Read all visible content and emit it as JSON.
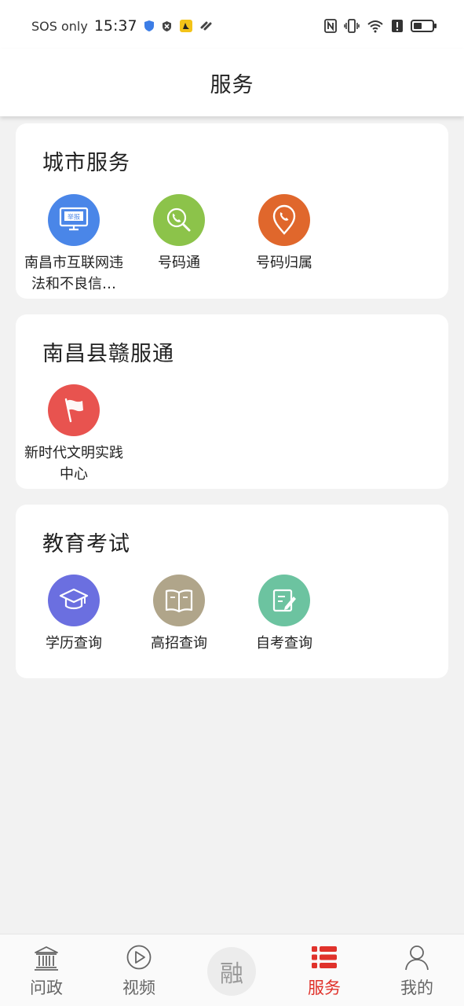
{
  "status_bar": {
    "carrier": "SOS only",
    "time": "15:37"
  },
  "header": {
    "title": "服务"
  },
  "sections": [
    {
      "title": "城市服务",
      "items": [
        {
          "label": "南昌市互联网违法和不良信…",
          "icon": "report-monitor-icon",
          "color": "#4a86e8",
          "badge": "举报"
        },
        {
          "label": "号码通",
          "icon": "phone-search-icon",
          "color": "#8cc34a"
        },
        {
          "label": "号码归属",
          "icon": "phone-location-icon",
          "color": "#e0672c"
        }
      ]
    },
    {
      "title": "南昌县赣服通",
      "items": [
        {
          "label": "新时代文明实践中心",
          "icon": "flag-icon",
          "color": "#e8534f"
        }
      ]
    },
    {
      "title": "教育考试",
      "items": [
        {
          "label": "学历查询",
          "icon": "graduation-cap-icon",
          "color": "#6b6fe0"
        },
        {
          "label": "高招查询",
          "icon": "open-book-icon",
          "color": "#b0a58a"
        },
        {
          "label": "自考查询",
          "icon": "edit-note-icon",
          "color": "#6cc3a0"
        }
      ]
    }
  ],
  "bottom_nav": [
    {
      "label": "问政",
      "icon": "government-building-icon",
      "active": false
    },
    {
      "label": "视频",
      "icon": "play-circle-icon",
      "active": false
    },
    {
      "label": "融",
      "icon": "center-rong-icon",
      "active": false
    },
    {
      "label": "服务",
      "icon": "list-icon",
      "active": true
    },
    {
      "label": "我的",
      "icon": "user-icon",
      "active": false
    }
  ],
  "colors": {
    "accent": "#e0322b",
    "background": "#f2f2f2"
  }
}
